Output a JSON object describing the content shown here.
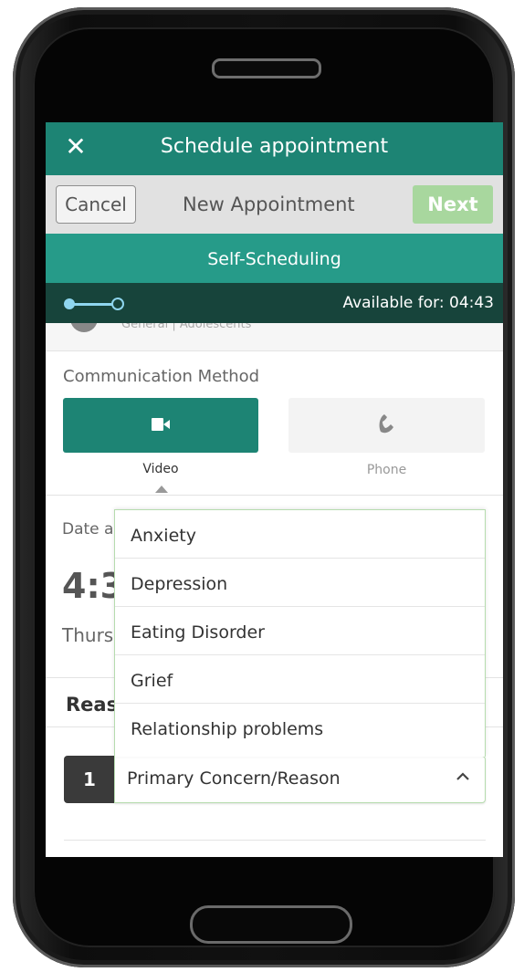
{
  "header": {
    "close_icon": "close-icon",
    "title": "Schedule appointment"
  },
  "subheader": {
    "cancel_label": "Cancel",
    "title": "New Appointment",
    "next_label": "Next"
  },
  "banner": {
    "label": "Self-Scheduling"
  },
  "progress": {
    "current_step": 1,
    "total_steps": 2,
    "available_label": "Available for: 04:43"
  },
  "provider": {
    "subtitle": "General | Adolescents"
  },
  "communication": {
    "label": "Communication Method",
    "options": [
      {
        "label": "Video",
        "icon": "video-camera-icon",
        "selected": true
      },
      {
        "label": "Phone",
        "icon": "phone-icon",
        "selected": false
      }
    ]
  },
  "datetime": {
    "label": "Date a",
    "time": "4:3",
    "date": "Thurs"
  },
  "reason": {
    "heading": "Reas",
    "number": "1",
    "select_value": "Primary Concern/Reason",
    "dropdown_options": [
      "Anxiety",
      "Depression",
      "Eating Disorder",
      "Grief",
      "Relationship problems"
    ]
  },
  "colors": {
    "primary": "#1d8474",
    "banner": "#269b89",
    "progress_bg": "#17443b",
    "next_button": "#a8d79e"
  }
}
